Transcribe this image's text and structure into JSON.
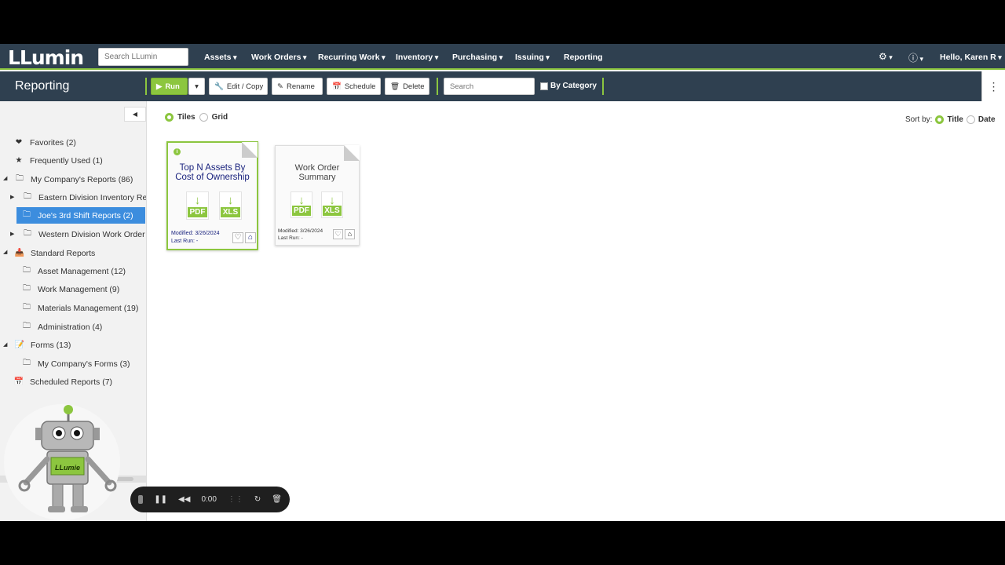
{
  "nav": {
    "logo_text": "LLumin",
    "search_placeholder": "Search LLumin",
    "menu": [
      "Assets",
      "Work Orders",
      "Recurring Work",
      "Inventory",
      "Purchasing",
      "Issuing",
      "Reporting"
    ],
    "user_greeting": "Hello, Karen R"
  },
  "toolbar": {
    "page_title": "Reporting",
    "run_label": "Run",
    "edit_label": "Edit / Copy",
    "rename_label": "Rename",
    "schedule_label": "Schedule",
    "delete_label": "Delete",
    "search_placeholder": "Search",
    "by_category_label": "By Category"
  },
  "sidebar": {
    "items": [
      {
        "label": "Favorites (2)",
        "icon": "heart-icon"
      },
      {
        "label": "Frequently Used (1)",
        "icon": "star-icon"
      },
      {
        "label": "My Company's Reports (86)",
        "icon": "folder-icon"
      },
      {
        "label": "Eastern Division Inventory Re",
        "icon": "folder-icon"
      },
      {
        "label": "Joe's 3rd Shift Reports (2)",
        "icon": "folder-icon",
        "selected": true
      },
      {
        "label": "Western Division Work Order",
        "icon": "folder-icon"
      },
      {
        "label": "Standard Reports",
        "icon": "inbox-icon"
      },
      {
        "label": "Asset Management (12)",
        "icon": "folder-icon"
      },
      {
        "label": "Work Management (9)",
        "icon": "folder-icon"
      },
      {
        "label": "Materials Management (19)",
        "icon": "folder-icon"
      },
      {
        "label": "Administration (4)",
        "icon": "folder-icon"
      },
      {
        "label": "Forms (13)",
        "icon": "form-icon"
      },
      {
        "label": "My Company's Forms (3)",
        "icon": "folder-icon"
      },
      {
        "label": "Scheduled Reports (7)",
        "icon": "calendar-icon"
      }
    ]
  },
  "view": {
    "tiles_label": "Tiles",
    "grid_label": "Grid",
    "selected": "Tiles",
    "sort_label": "Sort by:",
    "sort_title": "Title",
    "sort_date": "Date",
    "sort_selected": "Title"
  },
  "tiles": [
    {
      "title": "Top N Assets By Cost of Ownership",
      "pdf": "PDF",
      "xls": "XLS",
      "modified": "Modified: 3/26/2024",
      "last_run": "Last Run: -"
    },
    {
      "title": "Work Order Summary",
      "pdf": "PDF",
      "xls": "XLS",
      "modified": "Modified: 3/26/2024",
      "last_run": "Last Run: -"
    }
  ],
  "mascot": {
    "label": "LLumie"
  },
  "player": {
    "time": "0:00"
  },
  "colors": {
    "nav_bg": "#2f4050",
    "accent": "#8cc63f",
    "selected": "#3c8dde"
  }
}
